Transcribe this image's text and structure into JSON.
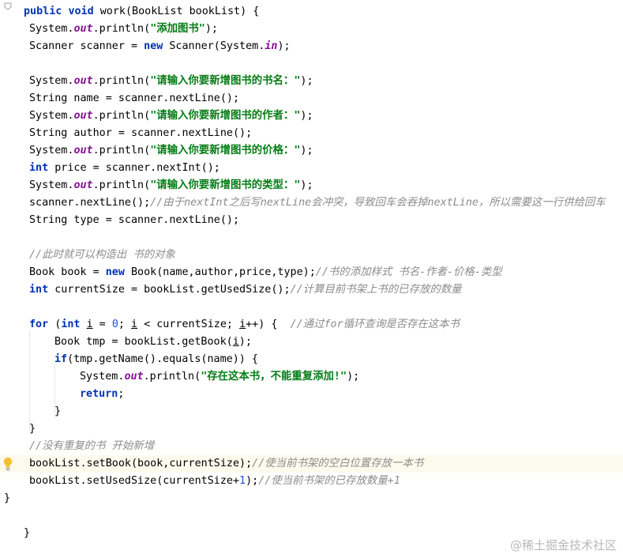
{
  "editor": {
    "lines": [
      {
        "segs": [
          [
            "kw",
            "public "
          ],
          [
            "kw",
            "void "
          ],
          [
            "p",
            "work(BookList bookList) {"
          ]
        ]
      },
      {
        "segs": [
          [
            "p",
            "System."
          ],
          [
            "field",
            "out"
          ],
          [
            "p",
            ".println("
          ],
          [
            "str",
            "\"添加图书\""
          ],
          [
            "p",
            ");"
          ]
        ]
      },
      {
        "segs": [
          [
            "p",
            "Scanner scanner = "
          ],
          [
            "kw",
            "new "
          ],
          [
            "p",
            "Scanner(System."
          ],
          [
            "field",
            "in"
          ],
          [
            "p",
            ");"
          ]
        ]
      },
      {
        "segs": []
      },
      {
        "segs": [
          [
            "p",
            "System."
          ],
          [
            "field",
            "out"
          ],
          [
            "p",
            ".println("
          ],
          [
            "str",
            "\"请输入你要新增图书的书名：\""
          ],
          [
            "p",
            ");"
          ]
        ]
      },
      {
        "segs": [
          [
            "p",
            "String name = scanner.nextLine();"
          ]
        ]
      },
      {
        "segs": [
          [
            "p",
            "System."
          ],
          [
            "field",
            "out"
          ],
          [
            "p",
            ".println("
          ],
          [
            "str",
            "\"请输入你要新增图书的作者：\""
          ],
          [
            "p",
            ");"
          ]
        ]
      },
      {
        "segs": [
          [
            "p",
            "String author = scanner.nextLine();"
          ]
        ]
      },
      {
        "segs": [
          [
            "p",
            "System."
          ],
          [
            "field",
            "out"
          ],
          [
            "p",
            ".println("
          ],
          [
            "str",
            "\"请输入你要新增图书的价格：\""
          ],
          [
            "p",
            ");"
          ]
        ]
      },
      {
        "segs": [
          [
            "kw",
            "int "
          ],
          [
            "p",
            "price = scanner.nextInt();"
          ]
        ]
      },
      {
        "segs": [
          [
            "p",
            "System."
          ],
          [
            "field",
            "out"
          ],
          [
            "p",
            ".println("
          ],
          [
            "str",
            "\"请输入你要新增图书的类型：\""
          ],
          [
            "p",
            ");"
          ]
        ]
      },
      {
        "segs": [
          [
            "p",
            "scanner.nextLine();"
          ],
          [
            "cmt",
            "//由于nextInt之后写nextLine会冲突，导致回车会吞掉nextLine，所以需要这一行供给回车"
          ]
        ]
      },
      {
        "segs": [
          [
            "p",
            "String type = scanner.nextLine();"
          ]
        ]
      },
      {
        "segs": []
      },
      {
        "segs": [
          [
            "cmt",
            "//此时就可以构造出 书的对象"
          ]
        ]
      },
      {
        "segs": [
          [
            "p",
            "Book book = "
          ],
          [
            "kw",
            "new "
          ],
          [
            "p",
            "Book(name,author,price,type);"
          ],
          [
            "cmt",
            "//书的添加样式 书名-作者-价格-类型"
          ]
        ]
      },
      {
        "segs": [
          [
            "kw",
            "int "
          ],
          [
            "p",
            "currentSize = bookList.getUsedSize();"
          ],
          [
            "cmt",
            "//计算目前书架上书的已存放的数量"
          ]
        ]
      },
      {
        "segs": []
      },
      {
        "segs": [
          [
            "kw",
            "for "
          ],
          [
            "p",
            "("
          ],
          [
            "kw",
            "int "
          ],
          [
            "ul",
            "i"
          ],
          [
            "p",
            " = "
          ],
          [
            "num",
            "0"
          ],
          [
            "p",
            "; "
          ],
          [
            "ul",
            "i"
          ],
          [
            "p",
            " < currentSize; "
          ],
          [
            "ul",
            "i"
          ],
          [
            "p",
            "++) {  "
          ],
          [
            "cmt",
            "//通过for循环查询是否存在这本书"
          ]
        ]
      },
      {
        "segs": [
          [
            "p",
            "Book tmp = bookList.getBook("
          ],
          [
            "ul",
            "i"
          ],
          [
            "p",
            ");"
          ]
        ]
      },
      {
        "segs": [
          [
            "kw",
            "if"
          ],
          [
            "p",
            "(tmp.getName().equals(name)) {"
          ]
        ]
      },
      {
        "segs": [
          [
            "p",
            "System."
          ],
          [
            "field",
            "out"
          ],
          [
            "p",
            ".println("
          ],
          [
            "str",
            "\"存在这本书，不能重复添加!\""
          ],
          [
            "p",
            ");"
          ]
        ]
      },
      {
        "segs": [
          [
            "kw",
            "return"
          ],
          [
            "p",
            ";"
          ]
        ]
      },
      {
        "segs": [
          [
            "p",
            "}"
          ]
        ]
      },
      {
        "segs": [
          [
            "p",
            "}"
          ]
        ]
      },
      {
        "segs": [
          [
            "cmt",
            "//没有重复的书 开始新增"
          ]
        ]
      },
      {
        "segs": [
          [
            "p",
            "bookList.setBook(book,currentSize);"
          ],
          [
            "cmt",
            "//使当前书架的空白位置存放一本书"
          ]
        ]
      },
      {
        "segs": [
          [
            "p",
            "bookList.setUsedSize(currentSize+"
          ],
          [
            "num",
            "1"
          ],
          [
            "p",
            ");"
          ],
          [
            "cmt",
            "//使当前书架的已存放数量+1"
          ]
        ]
      },
      {
        "segs": [
          [
            "p",
            "}"
          ]
        ]
      },
      {
        "segs": []
      },
      {
        "segs": [
          [
            "p",
            "}"
          ]
        ]
      }
    ]
  },
  "watermark": "@稀土掘金技术社区",
  "icons": {
    "intention": "lightbulb-icon",
    "fold": "fold-marker-icon"
  },
  "colors": {
    "keyword": "#0033b3",
    "string": "#067d17",
    "comment": "#8c8c8c",
    "static_field": "#871094",
    "number": "#1750eb",
    "current_line": "#fcfaed"
  }
}
